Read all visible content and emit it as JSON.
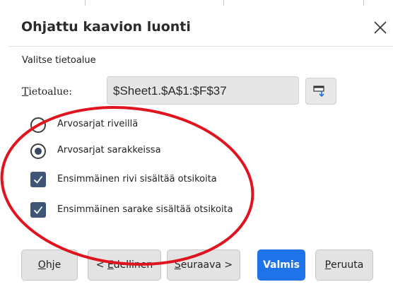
{
  "dialog": {
    "title": "Ohjattu kaavion luonti",
    "section_label": "Valitse tietoalue",
    "range": {
      "label_prefix": "T",
      "label_rest": "ietoalue:",
      "value": "$Sheet1.$A$1:$F$37"
    },
    "options": {
      "rows_label": "Arvosarjat riveillä",
      "rows_selected": false,
      "columns_label": "Arvosarjat sarakkeissa",
      "columns_selected": true,
      "first_row_label": "Ensimmäinen rivi sisältää otsikoita",
      "first_row_checked": true,
      "first_col_label": "Ensimmäinen sarake sisältää otsikoita",
      "first_col_checked": true
    },
    "buttons": {
      "help_u": "O",
      "help_rest": "hje",
      "back_pre": "< ",
      "back_u": "E",
      "back_rest": "dellinen",
      "next_u": "S",
      "next_rest": "euraava >",
      "finish": "Valmis",
      "cancel_u": "P",
      "cancel_rest": "eruuta"
    }
  },
  "colors": {
    "primary_button": "#1e73e8",
    "checkbox": "#3f5576",
    "annotation_ellipse": "#e0141e"
  },
  "icons": {
    "close": "close-icon",
    "shrink": "shrink-dialog-icon",
    "check": "checkmark-icon"
  }
}
